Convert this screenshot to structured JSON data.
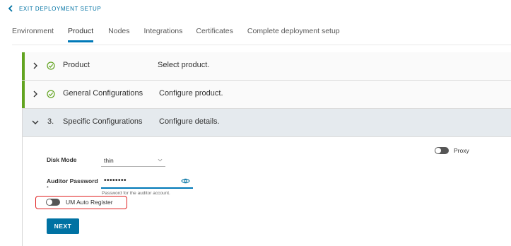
{
  "header": {
    "exit_label": "EXIT DEPLOYMENT SETUP"
  },
  "tabs": [
    {
      "label": "Environment",
      "active": false
    },
    {
      "label": "Product",
      "active": true
    },
    {
      "label": "Nodes",
      "active": false
    },
    {
      "label": "Integrations",
      "active": false
    },
    {
      "label": "Certificates",
      "active": false
    },
    {
      "label": "Complete deployment setup",
      "active": false
    }
  ],
  "steps": [
    {
      "title": "Product",
      "description": "Select product.",
      "status": "done"
    },
    {
      "title": "General Configurations",
      "description": "Configure product.",
      "status": "done"
    },
    {
      "number": "3.",
      "title": "Specific Configurations",
      "description": "Configure details.",
      "status": "active"
    }
  ],
  "form": {
    "disk_mode": {
      "label": "Disk Mode",
      "value": "thin"
    },
    "auditor_password": {
      "label": "Auditor Password",
      "required_mark": "*",
      "value": "••••••••",
      "helper": "Password for the auditor account."
    },
    "um_auto_register": {
      "label": "UM Auto Register",
      "on": false
    },
    "proxy": {
      "label": "Proxy",
      "on": false
    },
    "next_label": "NEXT"
  },
  "colors": {
    "accent": "#0072a3",
    "success": "#62a420",
    "highlight": "#e02020"
  }
}
